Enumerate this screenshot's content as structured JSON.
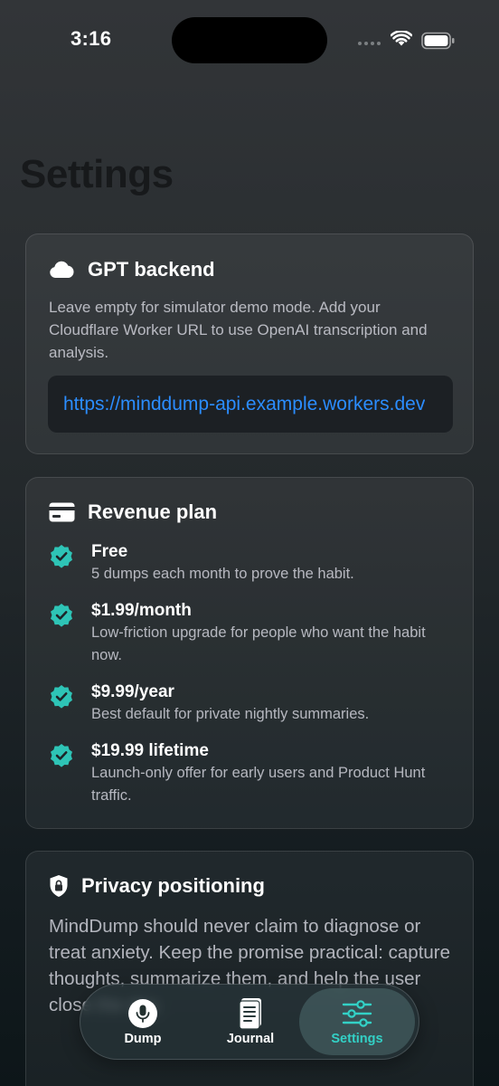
{
  "status_bar": {
    "time": "3:16"
  },
  "page": {
    "title": "Settings"
  },
  "gpt_card": {
    "title": "GPT backend",
    "icon": "cloud-icon",
    "description": "Leave empty for simulator demo mode. Add your Cloudflare Worker URL to use OpenAI transcription and analysis.",
    "url_value": "https://minddump-api.example.workers.dev"
  },
  "revenue_card": {
    "title": "Revenue plan",
    "icon": "credit-card-icon",
    "plans": [
      {
        "name": "Free",
        "description": "5 dumps each month to prove the habit."
      },
      {
        "name": "$1.99/month",
        "description": "Low-friction upgrade for people who want the habit now."
      },
      {
        "name": "$9.99/year",
        "description": "Best default for private nightly summaries."
      },
      {
        "name": "$19.99 lifetime",
        "description": "Launch-only offer for early users and Product Hunt traffic."
      }
    ]
  },
  "privacy_card": {
    "title": "Privacy positioning",
    "icon": "lock-shield-icon",
    "body": "MindDump should never claim to diagnose or treat anxiety. Keep the promise practical: capture thoughts, summarize them, and help the user close the day."
  },
  "tab_bar": {
    "tabs": [
      {
        "label": "Dump",
        "icon": "microphone-icon"
      },
      {
        "label": "Journal",
        "icon": "journal-icon"
      },
      {
        "label": "Settings",
        "icon": "sliders-icon"
      }
    ],
    "selected": "Settings"
  },
  "colors": {
    "accent": "#33d1c6",
    "link": "#2b8dff",
    "check": "#2ec4b6"
  }
}
